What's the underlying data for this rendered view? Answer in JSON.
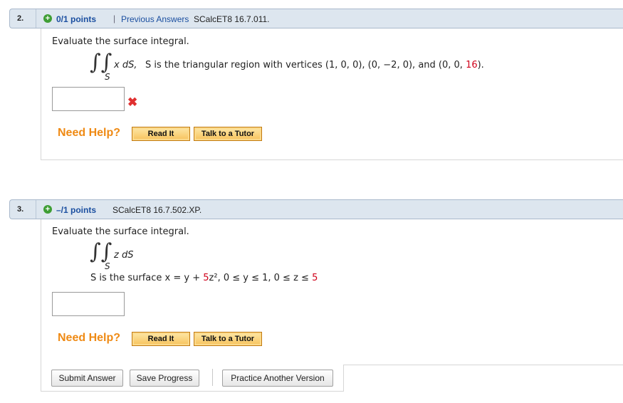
{
  "q2": {
    "number": "2.",
    "points": "0/1 points",
    "separator": "|",
    "previous_answers": "Previous Answers",
    "code": "SCalcET8 16.7.011.",
    "prompt": "Evaluate the surface integral.",
    "integrand": "x dS,",
    "sub": "S",
    "desc_pre": "S is the triangular region with vertices (1, 0, 0), (0, −2, 0), and (0, 0, ",
    "desc_red": "16",
    "desc_post": ").",
    "answer_value": "",
    "status_icon": "x-mark-icon",
    "need_help": "Need Help?",
    "read_it": "Read It",
    "talk_tutor": "Talk to a Tutor"
  },
  "q3": {
    "number": "3.",
    "points": "–/1 points",
    "code": "SCalcET8 16.7.502.XP.",
    "prompt": "Evaluate the surface integral.",
    "integrand": "z dS",
    "sub": "S",
    "surface_pre": "S is the surface  x = y + ",
    "surface_red1": "5",
    "surface_mid": "z², 0 ≤ y ≤ 1, 0 ≤ z ≤ ",
    "surface_red2": "5",
    "answer_value": "",
    "need_help": "Need Help?",
    "read_it": "Read It",
    "talk_tutor": "Talk to a Tutor"
  },
  "footer": {
    "submit": "Submit Answer",
    "save": "Save Progress",
    "practice": "Practice Another Version"
  },
  "colors": {
    "header_bg": "#dde6ef",
    "link": "#1b4fa0",
    "need_help": "#ef8a14",
    "red": "#d0021b",
    "plus_green": "#3f9e35"
  }
}
